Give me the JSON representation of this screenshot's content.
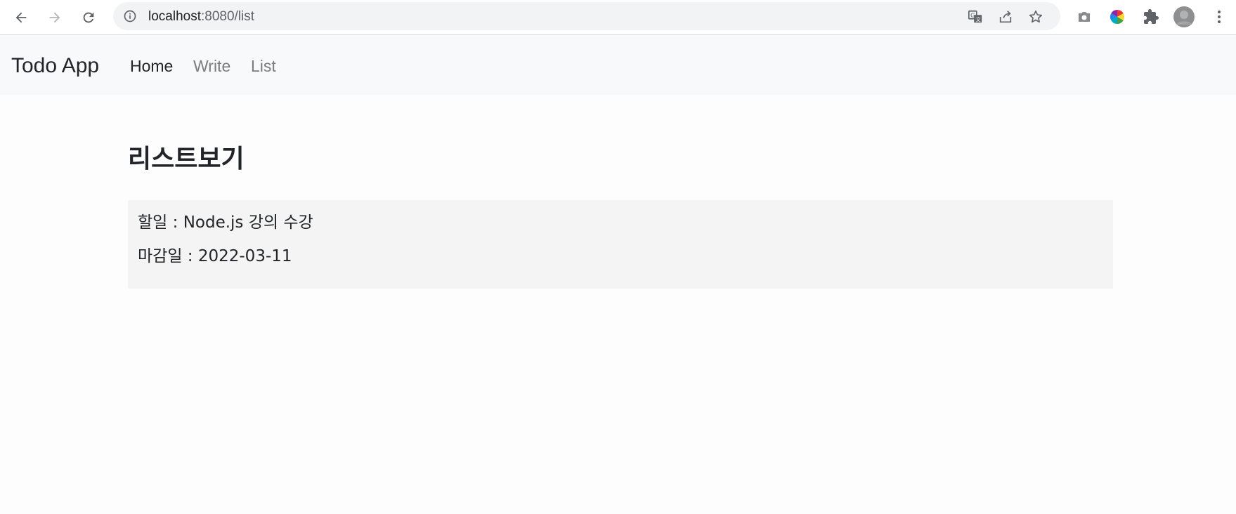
{
  "browser": {
    "url_host": "localhost",
    "url_rest": ":8080/list",
    "icons": [
      "back-icon",
      "forward-icon",
      "reload-icon",
      "info-icon",
      "translate-icon",
      "share-icon",
      "bookmark-star-icon",
      "camera-icon",
      "color-wheel-icon",
      "extensions-icon",
      "profile-avatar",
      "menu-icon"
    ]
  },
  "navbar": {
    "brand": "Todo App",
    "links": [
      {
        "label": "Home",
        "active": true
      },
      {
        "label": "Write",
        "active": false
      },
      {
        "label": "List",
        "active": false
      }
    ]
  },
  "main": {
    "title": "리스트보기",
    "items": [
      {
        "todo_line": "할일 : Node.js 강의 수강",
        "due_line": "마감일 : 2022-03-11"
      }
    ]
  },
  "colors": {
    "navbar_bg": "#f8f9fa",
    "card_bg": "#f4f4f4",
    "text": "#212529",
    "muted_link": "#7a7c7e"
  }
}
